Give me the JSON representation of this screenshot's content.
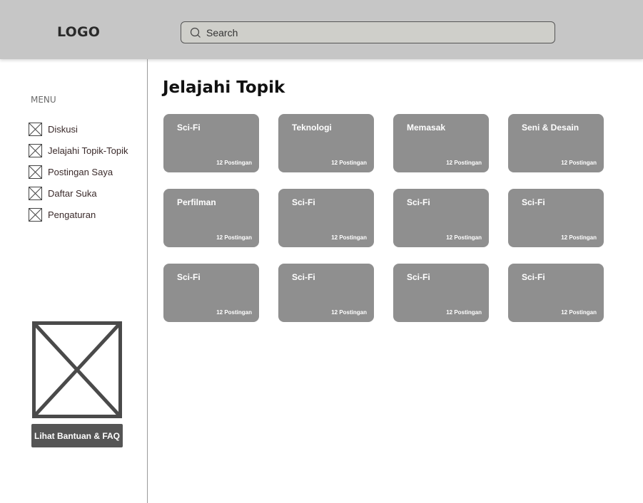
{
  "header": {
    "logo": "LOGO",
    "search_placeholder": "Search"
  },
  "sidebar": {
    "menu_title": "MENU",
    "items": [
      {
        "label": "Diskusi"
      },
      {
        "label": "Jelajahi Topik-Topik"
      },
      {
        "label": "Postingan Saya"
      },
      {
        "label": "Daftar Suka"
      },
      {
        "label": "Pengaturan"
      }
    ],
    "help_button": "Lihat Bantuan & FAQ"
  },
  "main": {
    "title": "Jelajahi Topik",
    "topics": [
      {
        "name": "Sci-Fi",
        "count": "12 Postingan"
      },
      {
        "name": "Teknologi",
        "count": "12 Postingan"
      },
      {
        "name": "Memasak",
        "count": "12 Postingan"
      },
      {
        "name": "Seni & Desain",
        "count": "12 Postingan"
      },
      {
        "name": "Perfilman",
        "count": "12 Postingan"
      },
      {
        "name": "Sci-Fi",
        "count": "12 Postingan"
      },
      {
        "name": "Sci-Fi",
        "count": "12 Postingan"
      },
      {
        "name": "Sci-Fi",
        "count": "12 Postingan"
      },
      {
        "name": "Sci-Fi",
        "count": "12 Postingan"
      },
      {
        "name": "Sci-Fi",
        "count": "12 Postingan"
      },
      {
        "name": "Sci-Fi",
        "count": "12 Postingan"
      },
      {
        "name": "Sci-Fi",
        "count": "12 Postingan"
      }
    ]
  },
  "colors": {
    "header_bg": "#c6c6c6",
    "card_bg": "#8f8f8f",
    "button_bg": "#555555"
  }
}
